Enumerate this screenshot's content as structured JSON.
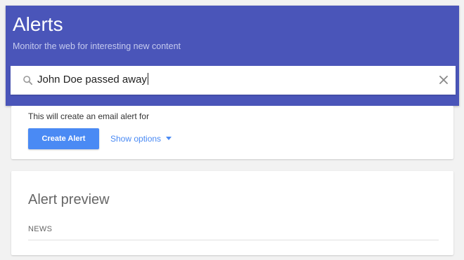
{
  "header": {
    "title": "Alerts",
    "subtitle": "Monitor the web for interesting new content",
    "background_color": "#4a55b9"
  },
  "search": {
    "value": "John Doe passed away",
    "search_icon": "search-icon",
    "clear_icon": "close-icon"
  },
  "create_card": {
    "email_text": "This will create an email alert for",
    "create_label": "Create Alert",
    "show_options_label": "Show options",
    "accent_color": "#4a8af4"
  },
  "preview_card": {
    "title": "Alert preview",
    "section_label": "NEWS"
  }
}
